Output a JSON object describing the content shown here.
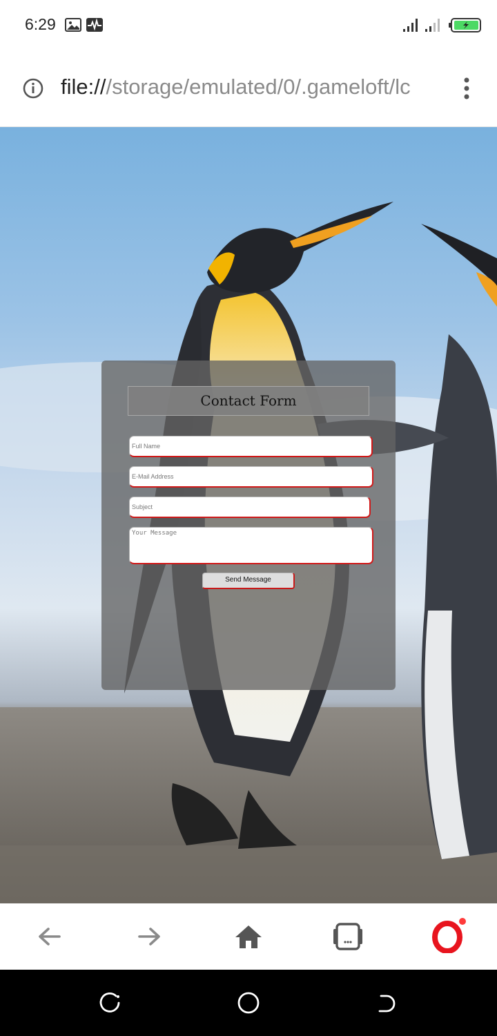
{
  "status_bar": {
    "time": "6:29",
    "icons": [
      "image-icon",
      "activity-icon",
      "signal-icon",
      "signal-weak-icon",
      "battery-charging-icon"
    ]
  },
  "url_bar": {
    "scheme": "file://",
    "path": "/storage/emulated/0/.gameloft/lc",
    "icons": [
      "info-icon",
      "more-vert-icon"
    ]
  },
  "page": {
    "background": "penguins-photo",
    "form": {
      "title": "Contact Form",
      "full_name_placeholder": "Full Name",
      "email_placeholder": "E-Mail Address",
      "subject_placeholder": "Subject",
      "message_placeholder": "Your Message",
      "send_label": "Send Message"
    }
  },
  "bottom_bar": {
    "icons": [
      "back-arrow-icon",
      "forward-arrow-icon",
      "home-icon",
      "tabs-icon",
      "opera-logo-icon"
    ],
    "notification_color": "#ff3b3b"
  },
  "system_nav": {
    "icons": [
      "recents-icon",
      "home-circle-icon",
      "back-icon"
    ]
  },
  "colors": {
    "accent_red": "#d01818",
    "opera_red": "#e8141e"
  }
}
